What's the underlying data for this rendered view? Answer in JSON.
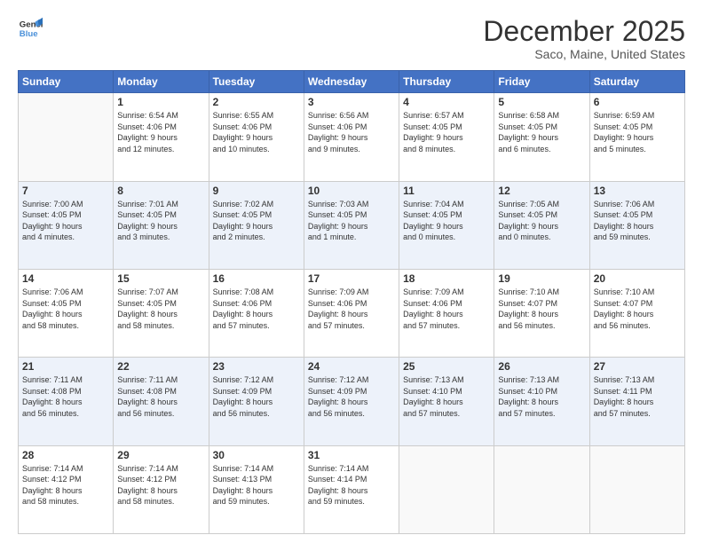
{
  "logo": {
    "line1": "General",
    "line2": "Blue"
  },
  "title": "December 2025",
  "location": "Saco, Maine, United States",
  "days_of_week": [
    "Sunday",
    "Monday",
    "Tuesday",
    "Wednesday",
    "Thursday",
    "Friday",
    "Saturday"
  ],
  "weeks": [
    [
      {
        "day": "",
        "info": ""
      },
      {
        "day": "1",
        "info": "Sunrise: 6:54 AM\nSunset: 4:06 PM\nDaylight: 9 hours\nand 12 minutes."
      },
      {
        "day": "2",
        "info": "Sunrise: 6:55 AM\nSunset: 4:06 PM\nDaylight: 9 hours\nand 10 minutes."
      },
      {
        "day": "3",
        "info": "Sunrise: 6:56 AM\nSunset: 4:06 PM\nDaylight: 9 hours\nand 9 minutes."
      },
      {
        "day": "4",
        "info": "Sunrise: 6:57 AM\nSunset: 4:05 PM\nDaylight: 9 hours\nand 8 minutes."
      },
      {
        "day": "5",
        "info": "Sunrise: 6:58 AM\nSunset: 4:05 PM\nDaylight: 9 hours\nand 6 minutes."
      },
      {
        "day": "6",
        "info": "Sunrise: 6:59 AM\nSunset: 4:05 PM\nDaylight: 9 hours\nand 5 minutes."
      }
    ],
    [
      {
        "day": "7",
        "info": "Sunrise: 7:00 AM\nSunset: 4:05 PM\nDaylight: 9 hours\nand 4 minutes."
      },
      {
        "day": "8",
        "info": "Sunrise: 7:01 AM\nSunset: 4:05 PM\nDaylight: 9 hours\nand 3 minutes."
      },
      {
        "day": "9",
        "info": "Sunrise: 7:02 AM\nSunset: 4:05 PM\nDaylight: 9 hours\nand 2 minutes."
      },
      {
        "day": "10",
        "info": "Sunrise: 7:03 AM\nSunset: 4:05 PM\nDaylight: 9 hours\nand 1 minute."
      },
      {
        "day": "11",
        "info": "Sunrise: 7:04 AM\nSunset: 4:05 PM\nDaylight: 9 hours\nand 0 minutes."
      },
      {
        "day": "12",
        "info": "Sunrise: 7:05 AM\nSunset: 4:05 PM\nDaylight: 9 hours\nand 0 minutes."
      },
      {
        "day": "13",
        "info": "Sunrise: 7:06 AM\nSunset: 4:05 PM\nDaylight: 8 hours\nand 59 minutes."
      }
    ],
    [
      {
        "day": "14",
        "info": "Sunrise: 7:06 AM\nSunset: 4:05 PM\nDaylight: 8 hours\nand 58 minutes."
      },
      {
        "day": "15",
        "info": "Sunrise: 7:07 AM\nSunset: 4:05 PM\nDaylight: 8 hours\nand 58 minutes."
      },
      {
        "day": "16",
        "info": "Sunrise: 7:08 AM\nSunset: 4:06 PM\nDaylight: 8 hours\nand 57 minutes."
      },
      {
        "day": "17",
        "info": "Sunrise: 7:09 AM\nSunset: 4:06 PM\nDaylight: 8 hours\nand 57 minutes."
      },
      {
        "day": "18",
        "info": "Sunrise: 7:09 AM\nSunset: 4:06 PM\nDaylight: 8 hours\nand 57 minutes."
      },
      {
        "day": "19",
        "info": "Sunrise: 7:10 AM\nSunset: 4:07 PM\nDaylight: 8 hours\nand 56 minutes."
      },
      {
        "day": "20",
        "info": "Sunrise: 7:10 AM\nSunset: 4:07 PM\nDaylight: 8 hours\nand 56 minutes."
      }
    ],
    [
      {
        "day": "21",
        "info": "Sunrise: 7:11 AM\nSunset: 4:08 PM\nDaylight: 8 hours\nand 56 minutes."
      },
      {
        "day": "22",
        "info": "Sunrise: 7:11 AM\nSunset: 4:08 PM\nDaylight: 8 hours\nand 56 minutes."
      },
      {
        "day": "23",
        "info": "Sunrise: 7:12 AM\nSunset: 4:09 PM\nDaylight: 8 hours\nand 56 minutes."
      },
      {
        "day": "24",
        "info": "Sunrise: 7:12 AM\nSunset: 4:09 PM\nDaylight: 8 hours\nand 56 minutes."
      },
      {
        "day": "25",
        "info": "Sunrise: 7:13 AM\nSunset: 4:10 PM\nDaylight: 8 hours\nand 57 minutes."
      },
      {
        "day": "26",
        "info": "Sunrise: 7:13 AM\nSunset: 4:10 PM\nDaylight: 8 hours\nand 57 minutes."
      },
      {
        "day": "27",
        "info": "Sunrise: 7:13 AM\nSunset: 4:11 PM\nDaylight: 8 hours\nand 57 minutes."
      }
    ],
    [
      {
        "day": "28",
        "info": "Sunrise: 7:14 AM\nSunset: 4:12 PM\nDaylight: 8 hours\nand 58 minutes."
      },
      {
        "day": "29",
        "info": "Sunrise: 7:14 AM\nSunset: 4:12 PM\nDaylight: 8 hours\nand 58 minutes."
      },
      {
        "day": "30",
        "info": "Sunrise: 7:14 AM\nSunset: 4:13 PM\nDaylight: 8 hours\nand 59 minutes."
      },
      {
        "day": "31",
        "info": "Sunrise: 7:14 AM\nSunset: 4:14 PM\nDaylight: 8 hours\nand 59 minutes."
      },
      {
        "day": "",
        "info": ""
      },
      {
        "day": "",
        "info": ""
      },
      {
        "day": "",
        "info": ""
      }
    ]
  ]
}
